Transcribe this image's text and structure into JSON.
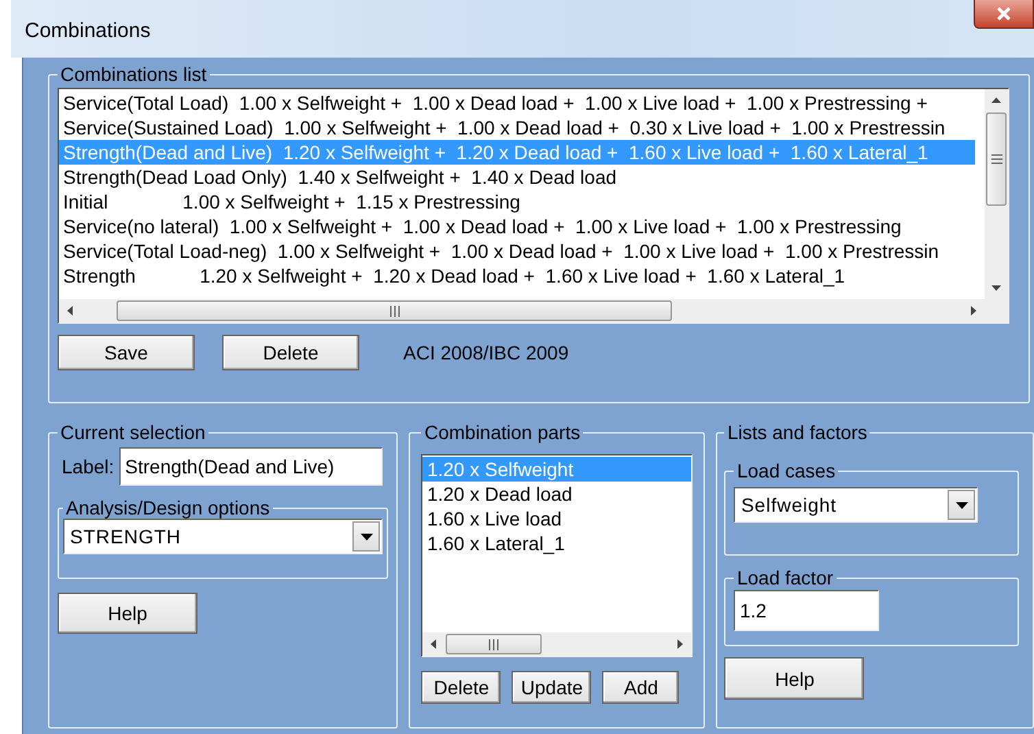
{
  "window": {
    "title": "Combinations"
  },
  "combinations_list": {
    "title": "Combinations list",
    "rows": [
      {
        "text": "Service(Total Load)  1.00 x Selfweight +  1.00 x Dead load +  1.00 x Live load +  1.00 x Prestressing +",
        "selected": false
      },
      {
        "text": "Service(Sustained Load)  1.00 x Selfweight +  1.00 x Dead load +  0.30 x Live load +  1.00 x Prestressin",
        "selected": false
      },
      {
        "text": "Strength(Dead and Live)  1.20 x Selfweight +  1.20 x Dead load +  1.60 x Live load +  1.60 x Lateral_1",
        "selected": true
      },
      {
        "text": "Strength(Dead Load Only)  1.40 x Selfweight +  1.40 x Dead load",
        "selected": false
      },
      {
        "text": "Initial              1.00 x Selfweight +  1.15 x Prestressing",
        "selected": false
      },
      {
        "text": "Service(no lateral)  1.00 x Selfweight +  1.00 x Dead load +  1.00 x Live load +  1.00 x Prestressing",
        "selected": false
      },
      {
        "text": "Service(Total Load-neg)  1.00 x Selfweight +  1.00 x Dead load +  1.00 x Live load +  1.00 x Prestressin",
        "selected": false
      },
      {
        "text": "Strength            1.20 x Selfweight +  1.20 x Dead load +  1.60 x Live load +  1.60 x Lateral_1",
        "selected": false
      }
    ],
    "buttons": [
      "Save",
      "Delete"
    ],
    "code": "ACI 2008/IBC 2009"
  },
  "current_selection": {
    "title": "Current selection",
    "label_caption": "Label:",
    "label_value": "Strength(Dead and Live)",
    "analysis": {
      "title": "Analysis/Design options",
      "value": "STRENGTH"
    },
    "help": "Help"
  },
  "combination_parts": {
    "title": "Combination parts",
    "items": [
      {
        "text": "1.20 x Selfweight",
        "selected": true
      },
      {
        "text": "1.20 x Dead load",
        "selected": false
      },
      {
        "text": "1.60 x Live load",
        "selected": false
      },
      {
        "text": "1.60 x Lateral_1",
        "selected": false
      }
    ],
    "buttons": [
      "Delete",
      "Update",
      "Add"
    ]
  },
  "lists_and_factors": {
    "title": "Lists and factors",
    "load_cases": {
      "title": "Load cases",
      "value": "Selfweight"
    },
    "load_factor": {
      "title": "Load factor",
      "value": "1.2"
    },
    "help": "Help"
  }
}
